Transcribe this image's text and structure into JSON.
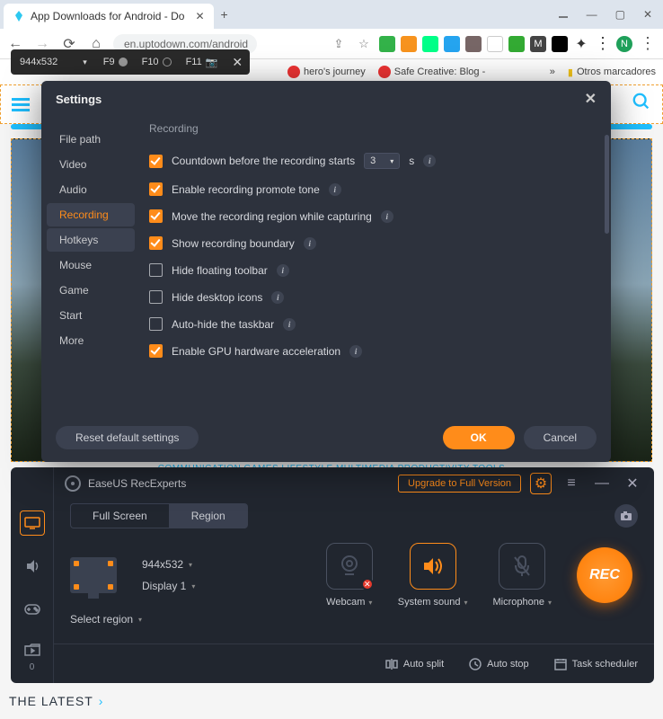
{
  "browser": {
    "tab_title": "App Downloads for Android - Do",
    "url": "en.uptodown.com/android",
    "bookmark1": "hero's journey",
    "bookmark2": "Safe Creative: Blog -",
    "bookmark_more": "»",
    "bookmark_other": "Otros marcadores"
  },
  "devbar": {
    "dimensions": "944x532",
    "f9": "F9",
    "f10": "F10",
    "f11": "F11"
  },
  "cats": "COMMUNICATION    GAMES    LIFESTYLE    MULTIMEDIA    PRODUCTIVITY    TOOLS",
  "latest": "THE LATEST",
  "settings": {
    "title": "Settings",
    "nav": [
      "File path",
      "Video",
      "Audio",
      "Recording",
      "Hotkeys",
      "Mouse",
      "Game",
      "Start",
      "More"
    ],
    "section_title": "Recording",
    "opts": {
      "countdown": "Countdown before the recording starts",
      "countdown_val": "3",
      "countdown_unit": "s",
      "promote": "Enable recording promote tone",
      "move_region": "Move the recording region while capturing",
      "boundary": "Show recording boundary",
      "floating": "Hide floating toolbar",
      "desktop": "Hide desktop icons",
      "taskbar": "Auto-hide the taskbar",
      "gpu": "Enable GPU hardware acceleration"
    },
    "buttons": {
      "reset": "Reset default settings",
      "ok": "OK",
      "cancel": "Cancel"
    }
  },
  "rec": {
    "app_title": "EaseUS RecExperts",
    "upgrade": "Upgrade to Full Version",
    "tab_full": "Full Screen",
    "tab_region": "Region",
    "res": "944x532",
    "display": "Display 1",
    "select_region": "Select region",
    "webcam": "Webcam",
    "system_sound": "System sound",
    "microphone": "Microphone",
    "rec_btn": "REC",
    "auto_split": "Auto split",
    "auto_stop": "Auto stop",
    "task_scheduler": "Task scheduler",
    "folder_count": "0"
  }
}
